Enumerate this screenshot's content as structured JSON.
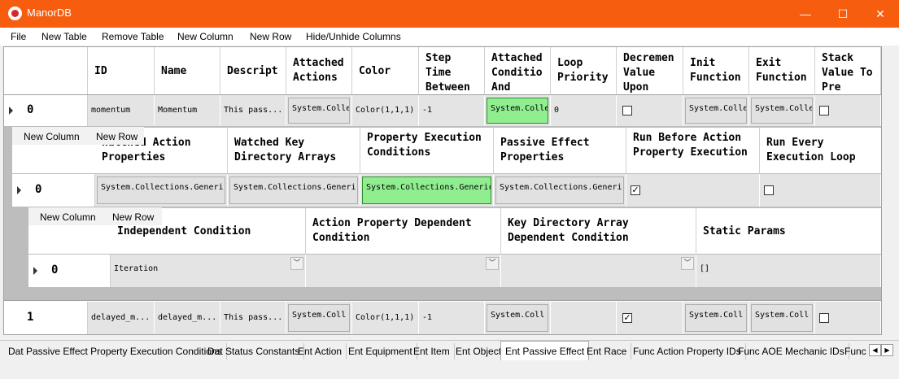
{
  "window": {
    "title": "ManorDB",
    "minimize_glyph": "—",
    "maximize_glyph": "☐",
    "close_glyph": "✕"
  },
  "menu": [
    "File",
    "New Table",
    "Remove Table",
    "New Column",
    "New Row",
    "Hide/Unhide Columns"
  ],
  "main_table": {
    "headers": [
      "ID",
      "Name",
      "Descript",
      "Attached Actions",
      "Color",
      "Step Time Between",
      "Attached Conditio And",
      "Loop Priority",
      "Decremen Value Upon",
      "Init Function",
      "Exit Function",
      "Stack Value To Pre"
    ],
    "row0": {
      "index": "0",
      "id": "momentum",
      "name": "Momentum",
      "description": "This pass...",
      "attached_actions": "System.Colle",
      "color": "Color(1,1,1)",
      "step_time": "-1",
      "attached_conditions": "System.Colle",
      "loop_priority": "0",
      "init_function": "System.Colle",
      "exit_function": "System.Colle"
    },
    "row1": {
      "index": "1",
      "id": "delayed_m...",
      "name": "delayed_m...",
      "description": "This pass...",
      "attached_actions": "System.Coll",
      "color": "Color(1,1,1)",
      "step_time": "-1",
      "attached_conditions": "System.Coll",
      "decrement_checked": "✓",
      "init_function": "System.Coll",
      "exit_function": "System.Coll"
    }
  },
  "popup1": {
    "new_column": "New Column",
    "new_row": "New Row"
  },
  "sub_table": {
    "headers": [
      "Watched Action Properties",
      "Watched Key Directory Arrays",
      "Property Execution Conditions",
      "Passive Effect Properties",
      "Run Before Action Property Execution",
      "Run Every Execution Loop"
    ],
    "row0": {
      "index": "0",
      "c1": "System.Collections.Generi",
      "c2": "System.Collections.Generi",
      "c3": "System.Collections.Generic",
      "c4": "System.Collections.Generi",
      "run_before_checked": "✓"
    }
  },
  "popup2": {
    "new_column": "New Column",
    "new_row": "New Row"
  },
  "subsub_table": {
    "headers": [
      "Independent Condition",
      "Action Property Dependent Condition",
      "Key Directory Array Dependent Condition",
      "Static Params"
    ],
    "row0": {
      "index": "0",
      "independent": "Iteration",
      "action_prop": "",
      "key_dir": "",
      "static_params": "[]"
    }
  },
  "tabs": [
    "Dat Passive Effect Property Execution Conditions",
    "Dat Status Constants",
    "Ent Action",
    "Ent Equipment",
    "Ent Item",
    "Ent Object",
    "Ent Passive Effect",
    "Ent Race",
    "Func Action Property IDs",
    "Func AOE Mechanic IDs",
    "Func"
  ],
  "active_tab": "Ent Passive Effect",
  "tab_scroll": {
    "left": "◀",
    "right": "▶"
  },
  "combo_arrow": "﹀",
  "colors": {
    "titlebar": "#f75d0f",
    "highlight": "#90ee90"
  }
}
